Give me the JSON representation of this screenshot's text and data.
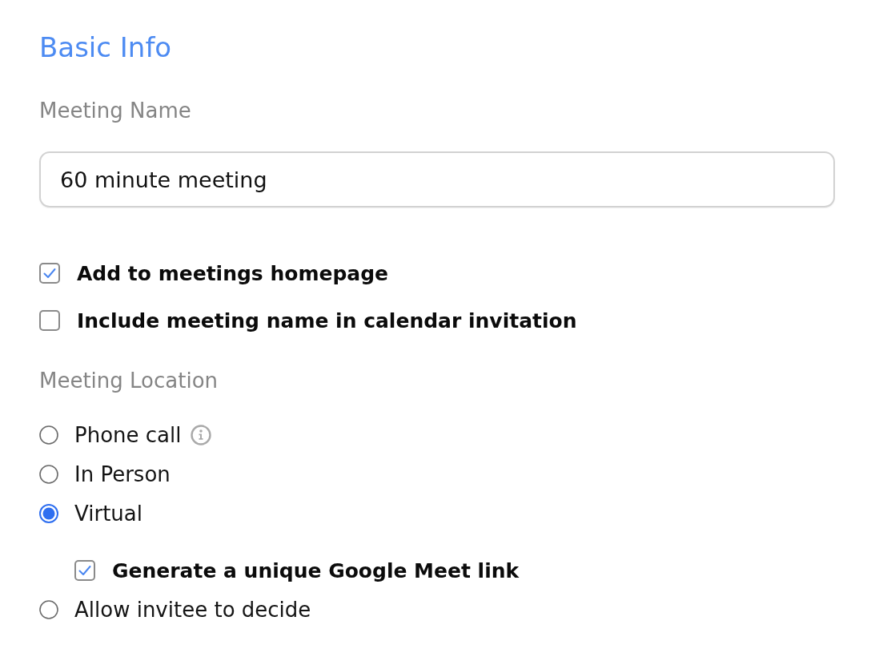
{
  "section": {
    "title": "Basic Info"
  },
  "meeting_name": {
    "label": "Meeting Name",
    "value": "60 minute meeting"
  },
  "options": [
    {
      "label": "Add to meetings homepage",
      "checked": true
    },
    {
      "label": "Include meeting name in calendar invitation",
      "checked": false
    }
  ],
  "meeting_location": {
    "label": "Meeting Location",
    "choices": [
      {
        "label": "Phone call",
        "selected": false,
        "info": true
      },
      {
        "label": "In Person",
        "selected": false,
        "info": false
      },
      {
        "label": "Virtual",
        "selected": true,
        "info": false,
        "sub_options": [
          {
            "label": "Generate a unique Google Meet link",
            "checked": true
          }
        ]
      },
      {
        "label": "Allow invitee to decide",
        "selected": false,
        "info": false
      }
    ]
  }
}
